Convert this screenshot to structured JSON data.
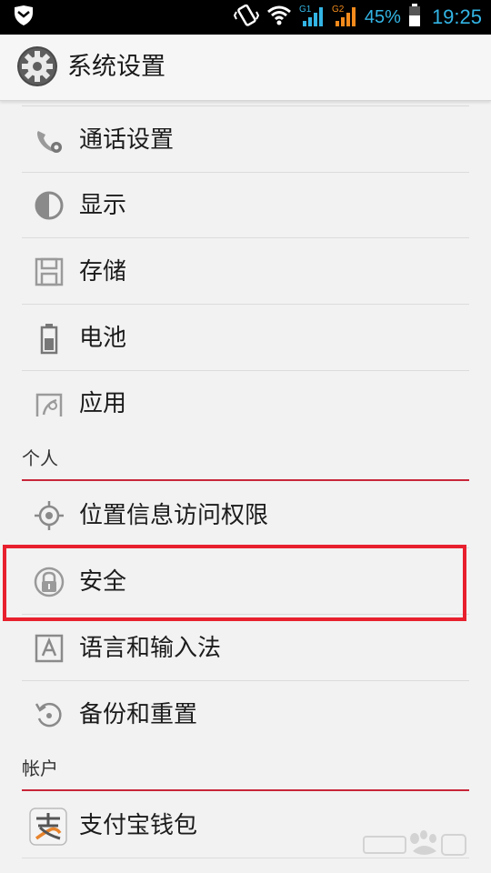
{
  "status_bar": {
    "battery": "45%",
    "time": "19:25",
    "sim1_label": "G1",
    "sim2_label": "G2"
  },
  "action_bar": {
    "title": "系统设置",
    "icon": "gear-icon"
  },
  "items": [
    {
      "label": "通话设置",
      "icon": "phone-settings-icon"
    },
    {
      "label": "显示",
      "icon": "display-icon"
    },
    {
      "label": "存储",
      "icon": "storage-icon"
    },
    {
      "label": "电池",
      "icon": "battery-icon"
    },
    {
      "label": "应用",
      "icon": "apps-icon"
    },
    {
      "label": "位置信息访问权限",
      "icon": "location-icon"
    },
    {
      "label": "安全",
      "icon": "lock-icon"
    },
    {
      "label": "语言和输入法",
      "icon": "language-icon"
    },
    {
      "label": "备份和重置",
      "icon": "backup-restore-icon"
    },
    {
      "label": "支付宝钱包",
      "icon": "alipay-icon"
    }
  ],
  "sections": {
    "personal": "个人",
    "accounts": "帐户"
  },
  "colors": {
    "accent_red": "#c8263a",
    "highlight_red": "#e8202e",
    "status_blue": "#33b5e5"
  }
}
